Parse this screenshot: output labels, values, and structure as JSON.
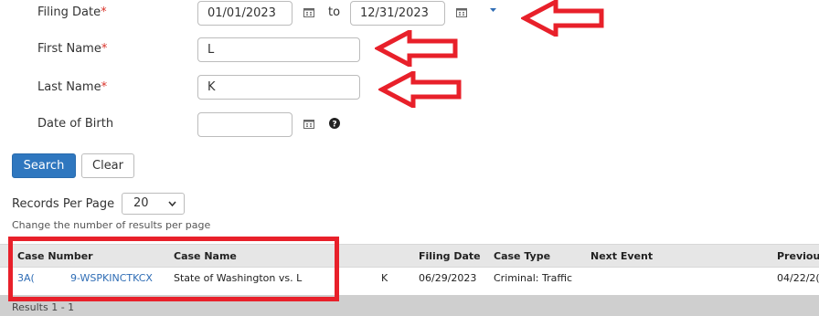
{
  "form": {
    "filing_date": {
      "label": "Filing Date",
      "required": "*",
      "from": "01/01/2023",
      "to_label": "to",
      "to": "12/31/2023"
    },
    "first_name": {
      "label": "First Name",
      "required": "*",
      "value": "L"
    },
    "last_name": {
      "label": "Last Name",
      "required": "*",
      "value": "K"
    },
    "dob": {
      "label": "Date of Birth",
      "value": ""
    }
  },
  "buttons": {
    "search": "Search",
    "clear": "Clear"
  },
  "records": {
    "label": "Records Per Page",
    "selected": "20",
    "hint": "Change the number of results per page"
  },
  "table": {
    "headers": [
      "Case Number",
      "Case Name",
      "Filing Date",
      "Case Type",
      "Next Event",
      "Previou"
    ],
    "rows": [
      {
        "case_number_a": "3A(",
        "case_number_b": "9-WSPKINCTKCX",
        "case_name": "State of Washington vs. L",
        "party_initial": "K",
        "filing_date": "06/29/2023",
        "case_type": "Criminal: Traffic",
        "next_event": "",
        "previous": "04/22/2("
      }
    ]
  },
  "footer": {
    "text": "Results 1 - 1"
  },
  "colors": {
    "accent": "#2f77bf",
    "annotation": "#e8202a"
  }
}
